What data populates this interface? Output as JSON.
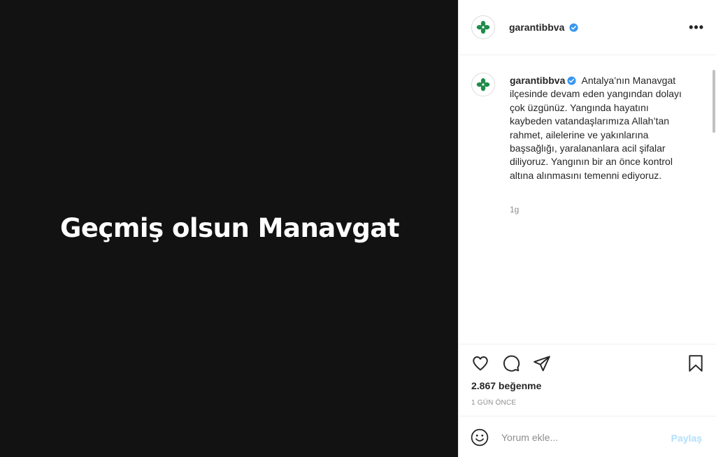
{
  "media": {
    "text": "Geçmiş olsun Manavgat",
    "background": "#121212"
  },
  "header": {
    "username": "garantibbva",
    "verified_icon": "verified-badge-icon",
    "more_icon": "•••"
  },
  "caption": {
    "username": "garantibbva",
    "text": "Antalya’nın Manavgat ilçesinde devam eden yangından dolayı çok üzgünüz. Yangında hayatını kaybeden vatandaşlarımıza Allah’tan rahmet, ailelerine ve yakınlarına başsağlığı, yaralananlara acil şifalar diliyoruz. Yangının bir an önce kontrol altına alınmasını temenni ediyoruz.",
    "time": "1g"
  },
  "actions": {
    "icons": [
      "heart-icon",
      "comment-icon",
      "share-icon",
      "bookmark-icon"
    ],
    "likes": "2.867 beğenme",
    "date": "1 GÜN ÖNCE"
  },
  "comment": {
    "placeholder": "Yorum ekle...",
    "post_label": "Paylaş"
  },
  "colors": {
    "verified": "#3897f0",
    "logo_green": "#1f8c4a",
    "post_disabled": "#b2dffc"
  }
}
